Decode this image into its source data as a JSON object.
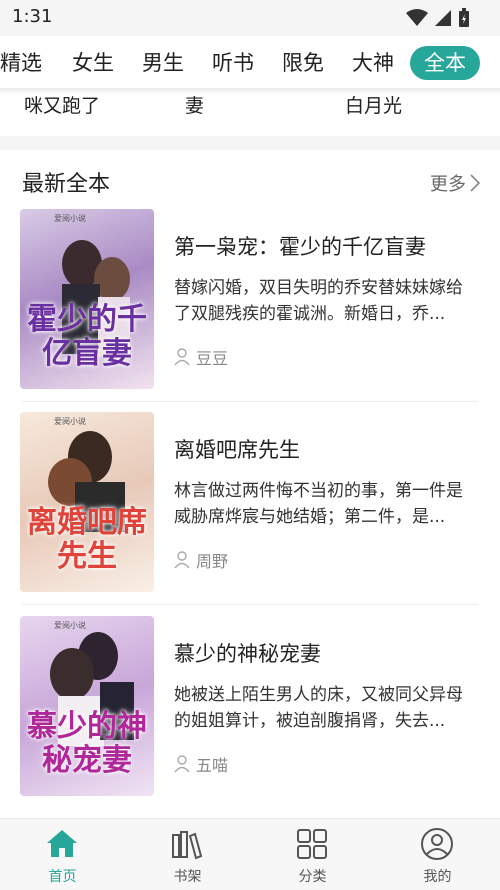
{
  "status_bar": {
    "time": "1:31"
  },
  "tabs": [
    {
      "label": "精选"
    },
    {
      "label": "女生"
    },
    {
      "label": "男生"
    },
    {
      "label": "听书"
    },
    {
      "label": "限免"
    },
    {
      "label": "大神"
    },
    {
      "label": "全本"
    }
  ],
  "prev_strip": [
    "咪又跑了",
    "妻",
    "白月光"
  ],
  "section": {
    "title": "最新全本",
    "more_label": "更多",
    "books": [
      {
        "title": "第一枭宠：霍少的千亿盲妻",
        "desc": "替嫁闪婚，双目失明的乔安替妹妹嫁给了双腿残疾的霍诚洲。新婚日，乔...",
        "author": "豆豆",
        "cover_text": "霍少的千亿盲妻"
      },
      {
        "title": "离婚吧席先生",
        "desc": "林言做过两件悔不当初的事，第一件是威胁席烨宸与她结婚；第二件，是...",
        "author": "周野",
        "cover_text": "离婚吧席先生"
      },
      {
        "title": "慕少的神秘宠妻",
        "desc": "她被送上陌生男人的床，又被同父异母的姐姐算计，被迫剖腹捐肾，失去...",
        "author": "五喵",
        "cover_text": "慕少的神秘宠妻"
      }
    ]
  },
  "bottom_nav": [
    {
      "label": "首页",
      "icon": "home-icon",
      "active": true
    },
    {
      "label": "书架",
      "icon": "bookshelf-icon",
      "active": false
    },
    {
      "label": "分类",
      "icon": "category-grid-icon",
      "active": false
    },
    {
      "label": "我的",
      "icon": "user-profile-icon",
      "active": false
    }
  ],
  "colors": {
    "accent": "#27a69a"
  }
}
